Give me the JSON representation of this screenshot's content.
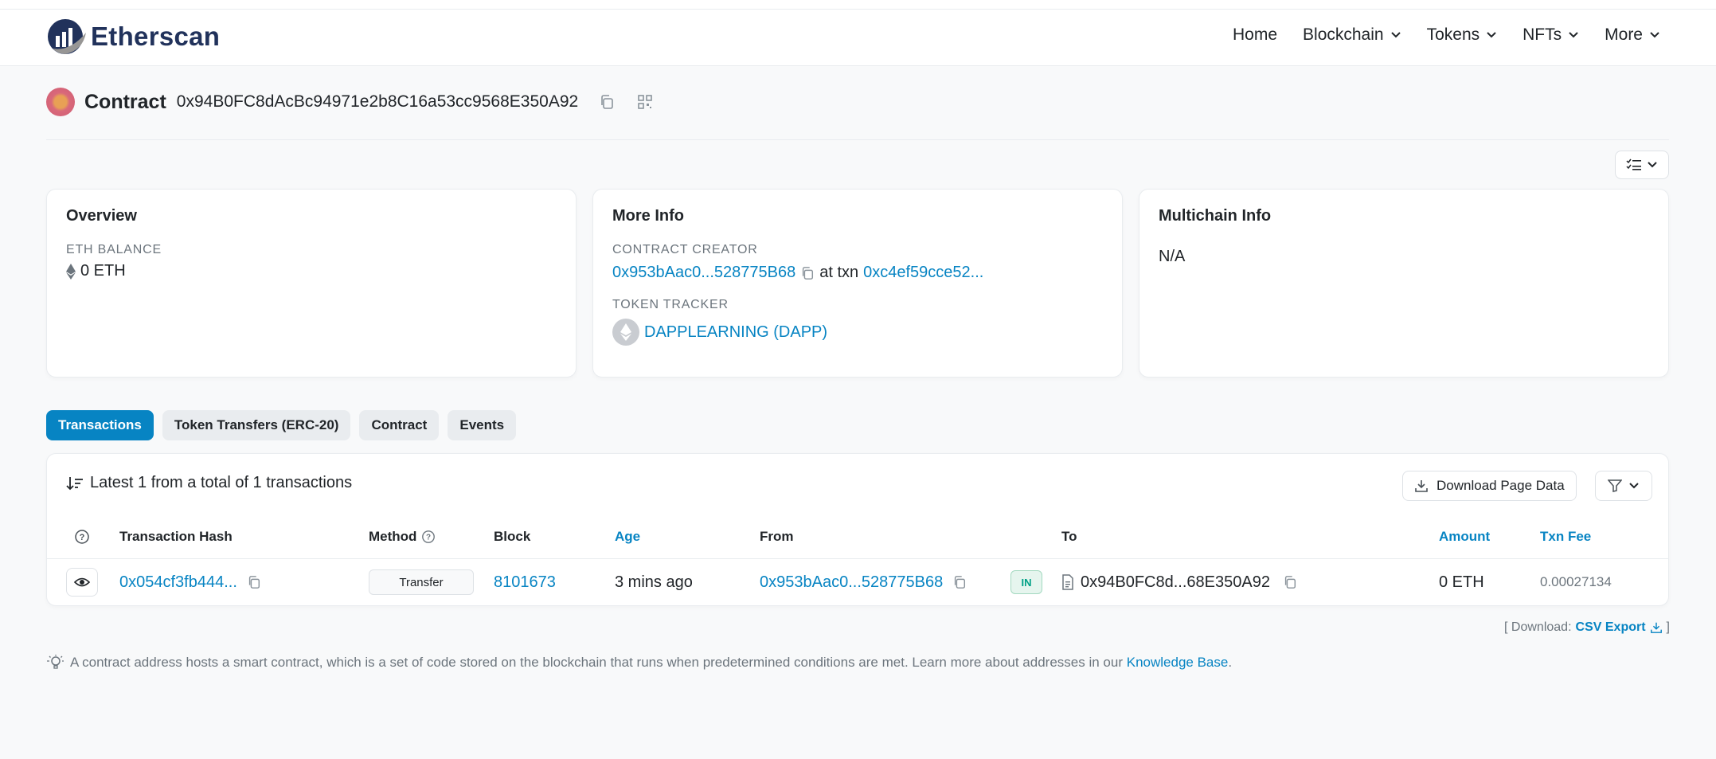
{
  "brand": {
    "name": "Etherscan",
    "color": "#21325b",
    "accent": "#0784c3"
  },
  "nav": [
    {
      "label": "Home",
      "has_menu": false
    },
    {
      "label": "Blockchain",
      "has_menu": true
    },
    {
      "label": "Tokens",
      "has_menu": true
    },
    {
      "label": "NFTs",
      "has_menu": true
    },
    {
      "label": "More",
      "has_menu": true
    }
  ],
  "contract": {
    "label": "Contract",
    "address": "0x94B0FC8dAcBc94971e2b8C16a53cc9568E350A92",
    "copy_icon": "copy-icon",
    "qr_icon": "qr-code-icon"
  },
  "overview": {
    "title": "Overview",
    "eth_balance_label": "ETH BALANCE",
    "eth_balance_value": "0 ETH"
  },
  "more_info": {
    "title": "More Info",
    "creator_label": "CONTRACT CREATOR",
    "creator_address": "0x953bAac0...528775B68",
    "at_txn_label": "at txn",
    "creator_txn": "0xc4ef59cce52...",
    "token_tracker_label": "TOKEN TRACKER",
    "token_tracker_value": "DAPPLEARNING (DAPP)"
  },
  "multichain": {
    "title": "Multichain Info",
    "value": "N/A"
  },
  "tabs": [
    {
      "label": "Transactions",
      "active": true
    },
    {
      "label": "Token Transfers (ERC-20)",
      "active": false
    },
    {
      "label": "Contract",
      "active": false
    },
    {
      "label": "Events",
      "active": false
    }
  ],
  "transactions": {
    "summary": "Latest 1 from a total of 1 transactions",
    "download_label": "Download Page Data",
    "columns": {
      "hash": "Transaction Hash",
      "method": "Method",
      "block": "Block",
      "age": "Age",
      "from": "From",
      "to": "To",
      "amount": "Amount",
      "fee": "Txn Fee"
    },
    "rows": [
      {
        "hash": "0x054cf3fb444...",
        "method": "Transfer",
        "block": "8101673",
        "age": "3 mins ago",
        "from": "0x953bAac0...528775B68",
        "direction": "IN",
        "to": "0x94B0FC8d...68E350A92",
        "amount": "0 ETH",
        "fee": "0.00027134"
      }
    ]
  },
  "csv": {
    "prefix": "[ Download:",
    "link": "CSV Export",
    "suffix": "]"
  },
  "footer_note": {
    "text": "A contract address hosts a smart contract, which is a set of code stored on the blockchain that runs when predetermined conditions are met. Learn more about addresses in our",
    "link": "Knowledge Base",
    "end": "."
  }
}
